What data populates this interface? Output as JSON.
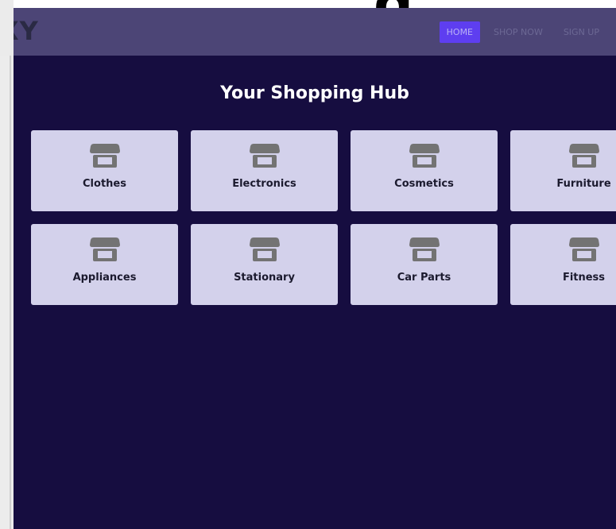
{
  "navbar": {
    "brand": "XY",
    "links": [
      {
        "label": "HOME",
        "active": true
      },
      {
        "label": "SHOP NOW",
        "active": false
      },
      {
        "label": "SIGN UP",
        "active": false
      }
    ]
  },
  "main": {
    "title": "Your Shopping Hub",
    "categories": [
      {
        "label": "Clothes",
        "icon": "store-icon"
      },
      {
        "label": "Electronics",
        "icon": "store-icon"
      },
      {
        "label": "Cosmetics",
        "icon": "store-icon"
      },
      {
        "label": "Furniture",
        "icon": "store-icon"
      },
      {
        "label": "Appliances",
        "icon": "store-icon"
      },
      {
        "label": "Stationary",
        "icon": "store-icon"
      },
      {
        "label": "Car Parts",
        "icon": "store-icon"
      },
      {
        "label": "Fitness",
        "icon": "store-icon"
      }
    ]
  },
  "colors": {
    "background": "#160d40",
    "navbar": "#4c4576",
    "accent": "#5e3ef0",
    "card": "#d3d1eb",
    "icon": "#737373"
  }
}
